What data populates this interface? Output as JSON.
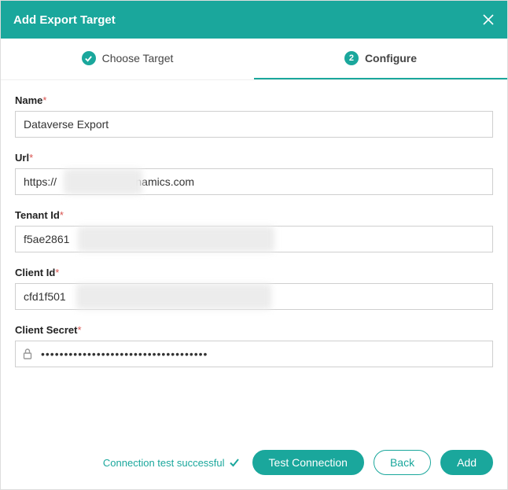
{
  "header": {
    "title": "Add Export Target"
  },
  "stepper": {
    "step1": {
      "label": "Choose Target"
    },
    "step2": {
      "label": "Configure",
      "number": "2"
    }
  },
  "fields": {
    "name": {
      "label": "Name",
      "required": "*",
      "value": "Dataverse Export"
    },
    "url": {
      "label": "Url",
      "required": "*",
      "value": "https://            .crm4.dynamics.com"
    },
    "tenant": {
      "label": "Tenant Id",
      "required": "*",
      "value": "f5ae2861"
    },
    "client": {
      "label": "Client Id",
      "required": "*",
      "value": "cfd1f501"
    },
    "secret": {
      "label": "Client Secret",
      "required": "*",
      "value": "••••••••••••••••••••••••••••••••••••"
    }
  },
  "footer": {
    "status": "Connection test successful",
    "test": "Test Connection",
    "back": "Back",
    "add": "Add"
  }
}
